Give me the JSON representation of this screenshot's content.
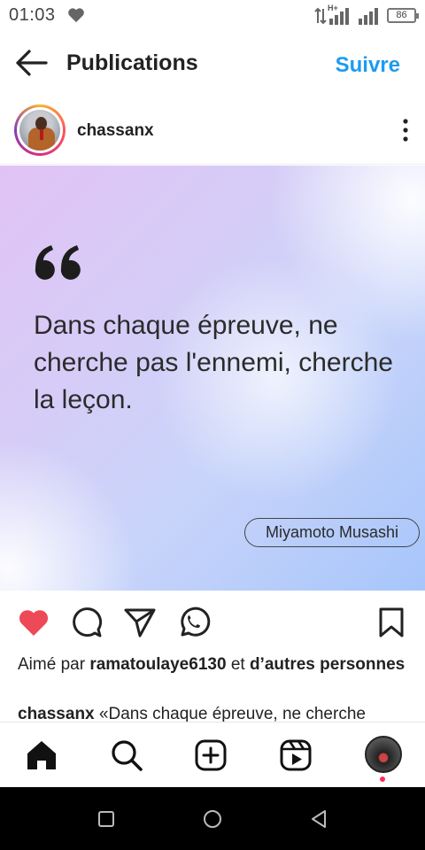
{
  "status_bar": {
    "time": "01:03",
    "network": "H+",
    "battery": "86",
    "icons": [
      "heart-icon",
      "data-arrows-icon",
      "signal-icon",
      "battery-icon"
    ]
  },
  "header": {
    "back_icon": "arrow-left-icon",
    "title": "Publications",
    "follow_label": "Suivre",
    "accent_color": "#1e9bf0"
  },
  "post": {
    "username": "chassanx",
    "more_icon": "more-vertical-icon",
    "quote": "Dans chaque épreuve, ne cherche pas l'ennemi, cherche la leçon.",
    "author": "Miyamoto Musashi",
    "liked": true,
    "like_color": "#ed4956",
    "likes": {
      "prefix": "Aimé par",
      "user": "ramatoulaye6130",
      "middle": "et",
      "suffix": "d’autres personnes"
    },
    "caption": {
      "user": "chassanx",
      "text": "«Dans chaque épreuve, ne cherche"
    },
    "action_icons": [
      "heart-icon",
      "comment-icon",
      "share-icon",
      "whatsapp-icon",
      "bookmark-icon"
    ]
  },
  "bottom_nav": {
    "items": [
      "home-icon",
      "search-icon",
      "create-icon",
      "reels-icon",
      "profile-avatar"
    ]
  },
  "system_nav": {
    "items": [
      "recents-icon",
      "home-circle-icon",
      "back-triangle-icon"
    ]
  }
}
